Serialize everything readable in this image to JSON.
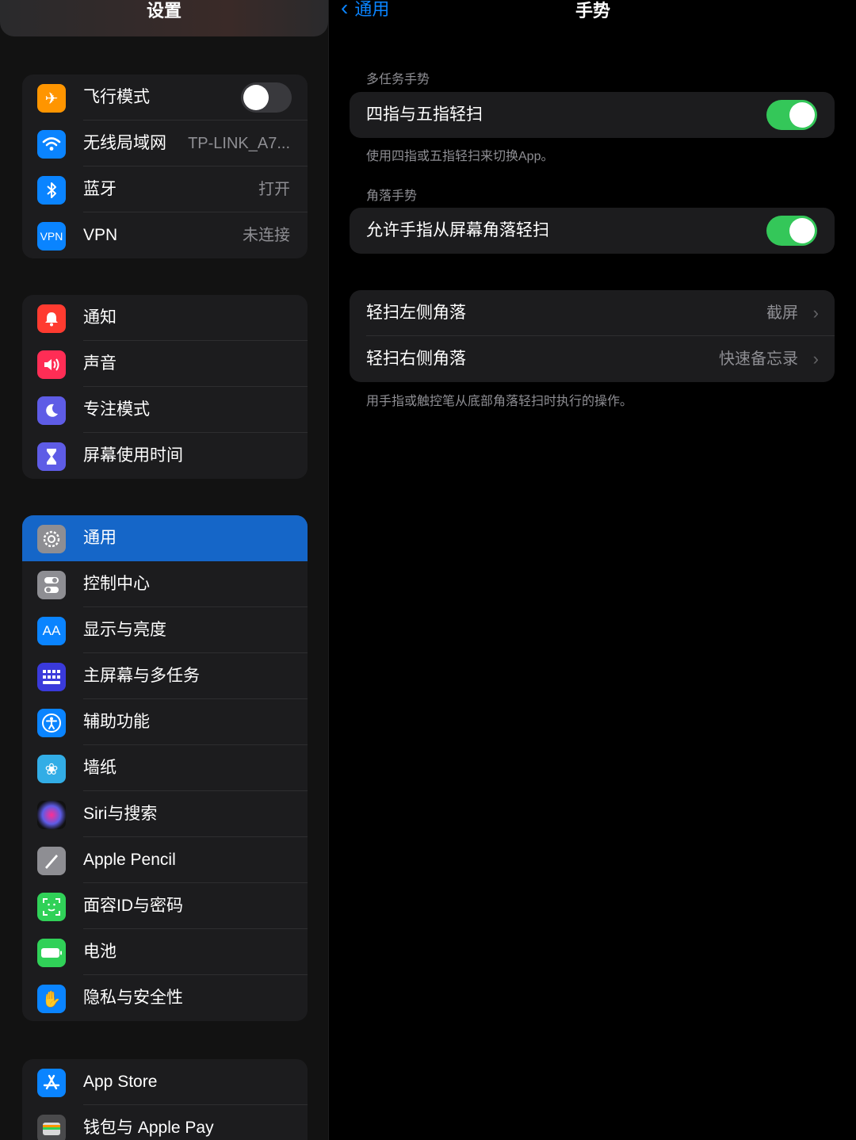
{
  "sidebar": {
    "title": "设置",
    "group1": [
      {
        "label": "飞行模式",
        "icon": "airplane-icon",
        "color": "#ff9500",
        "toggle": false
      },
      {
        "label": "无线局域网",
        "value": "TP-LINK_A7...",
        "icon": "wifi-icon",
        "color": "#0a84ff"
      },
      {
        "label": "蓝牙",
        "value": "打开",
        "icon": "bluetooth-icon",
        "color": "#0a84ff"
      },
      {
        "label": "VPN",
        "value": "未连接",
        "icon": "vpn-icon",
        "icon_text": "VPN",
        "color": "#0a84ff"
      }
    ],
    "group2": [
      {
        "label": "通知",
        "icon": "notification-bell-icon",
        "color": "#ff3b30"
      },
      {
        "label": "声音",
        "icon": "speaker-icon",
        "color": "#ff2d55"
      },
      {
        "label": "专注模式",
        "icon": "moon-icon",
        "color": "#5e5ce6"
      },
      {
        "label": "屏幕使用时间",
        "icon": "hourglass-icon",
        "color": "#5e5ce6"
      }
    ],
    "group3": [
      {
        "label": "通用",
        "icon": "gear-icon",
        "color": "#8e8e93",
        "selected": true
      },
      {
        "label": "控制中心",
        "icon": "switches-icon",
        "color": "#8e8e93"
      },
      {
        "label": "显示与亮度",
        "icon": "text-size-icon",
        "icon_text": "AA",
        "color": "#0a84ff"
      },
      {
        "label": "主屏幕与多任务",
        "icon": "app-grid-icon",
        "color": "#3a3adb"
      },
      {
        "label": "辅助功能",
        "icon": "accessibility-icon",
        "color": "#0a84ff"
      },
      {
        "label": "墙纸",
        "icon": "flower-icon",
        "color": "#32ade6"
      },
      {
        "label": "Siri与搜索",
        "icon": "siri-icon",
        "color": "#1c1c1e"
      },
      {
        "label": "Apple Pencil",
        "icon": "pencil-icon",
        "color": "#8e8e93"
      },
      {
        "label": "面容ID与密码",
        "icon": "face-id-icon",
        "color": "#30d158"
      },
      {
        "label": "电池",
        "icon": "battery-icon",
        "color": "#30d158"
      },
      {
        "label": "隐私与安全性",
        "icon": "hand-icon",
        "color": "#0a84ff"
      }
    ],
    "group4": [
      {
        "label": "App Store",
        "icon": "app-store-icon",
        "color": "#0a84ff"
      },
      {
        "label": "钱包与 Apple Pay",
        "icon": "wallet-icon",
        "color": "#4a4a4c"
      }
    ]
  },
  "detail": {
    "back_label": "通用",
    "title": "手势",
    "section1_header": "多任务手势",
    "four_five_finger": {
      "label": "四指与五指轻扫",
      "toggle": true
    },
    "section1_footer": "使用四指或五指轻扫来切换App。",
    "section2_header": "角落手势",
    "corner_swipe": {
      "label": "允许手指从屏幕角落轻扫",
      "toggle": true
    },
    "left_corner": {
      "label": "轻扫左侧角落",
      "value": "截屏"
    },
    "right_corner": {
      "label": "轻扫右侧角落",
      "value": "快速备忘录"
    },
    "section2_footer": "用手指或触控笔从底部角落轻扫时执行的操作。"
  },
  "colors": {
    "accent": "#0a84ff",
    "toggle_on": "#34c759",
    "selected_row": "#1566c8"
  }
}
